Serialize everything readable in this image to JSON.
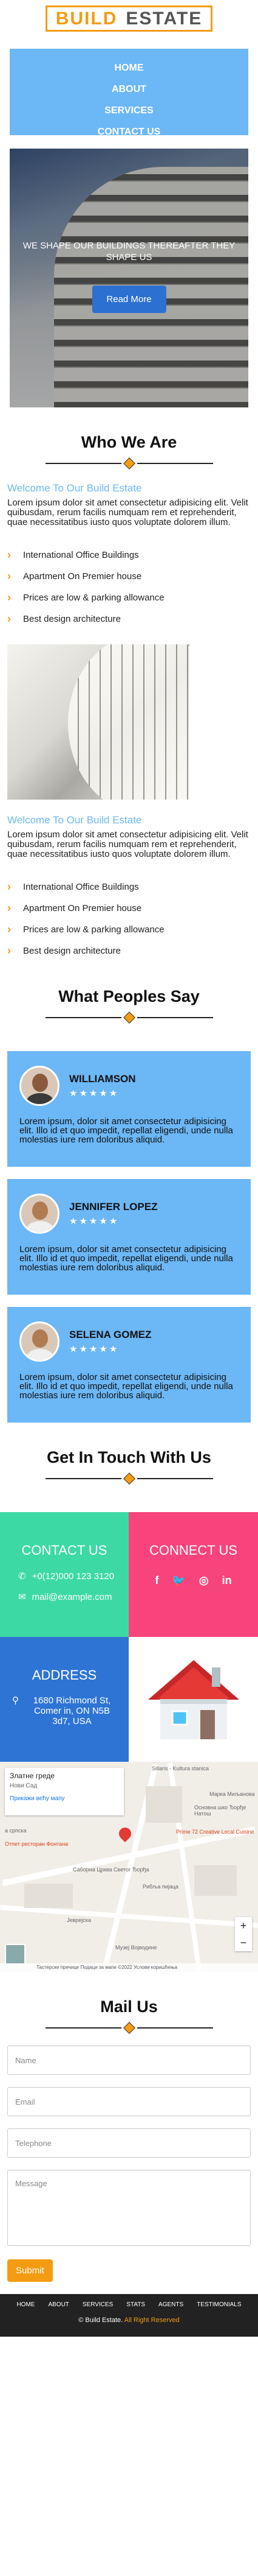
{
  "brand": {
    "part1": "BUILD",
    "part2": "ESTATE"
  },
  "nav": [
    "HOME",
    "ABOUT",
    "SERVICES",
    "CONTACT US"
  ],
  "hero": {
    "headline": "WE SHAPE OUR BUILDINGS THEREAFTER THEY SHAPE US",
    "button": "Read More"
  },
  "about": {
    "title": "Who We Are",
    "blocks": [
      {
        "heading": "Welcome To Our Build Estate",
        "text": "Lorem ipsum dolor sit amet consectetur adipisicing elit. Velit quibusdam, rerum facilis numquam rem et reprehenderit, quae necessitatibus iusto quos voluptate dolorem illum.",
        "features": [
          "International Office Buildings",
          "Apartment On Premier house",
          "Prices are low & parking allowance",
          "Best design architecture"
        ]
      },
      {
        "heading": "Welcome To Our Build Estate",
        "text": "Lorem ipsum dolor sit amet consectetur adipisicing elit. Velit quibusdam, rerum facilis numquam rem et reprehenderit, quae necessitatibus iusto quos voluptate dolorem illum.",
        "features": [
          "International Office Buildings",
          "Apartment On Premier house",
          "Prices are low & parking allowance",
          "Best design architecture"
        ]
      }
    ]
  },
  "testimonials": {
    "title": "What Peoples Say",
    "items": [
      {
        "name": "WILLIAMSON",
        "rating": "★★★★★",
        "text": "Lorem ipsum, dolor sit amet consectetur adipisicing elit. Illo id et quo impedit, repellat eligendi, unde nulla molestias iure rem doloribus aliquid."
      },
      {
        "name": "JENNIFER LOPEZ",
        "rating": "★★★★★",
        "text": "Lorem ipsum, dolor sit amet consectetur adipisicing elit. Illo id et quo impedit, repellat eligendi, unde nulla molestias iure rem doloribus aliquid."
      },
      {
        "name": "SELENA GOMEZ",
        "rating": "★★★★★",
        "text": "Lorem ipsum, dolor sit amet consectetur adipisicing elit. Illo id et quo impedit, repellat eligendi, unde nulla molestias iure rem doloribus aliquid."
      }
    ]
  },
  "contact": {
    "title": "Get In Touch With Us",
    "contact_us": {
      "heading": "CONTACT US",
      "phone": "+0(12)000 123 3120",
      "email": "mail@example.com"
    },
    "connect_us": {
      "heading": "CONNECT US",
      "socials": [
        "f",
        "🐦",
        "◎",
        "in"
      ]
    },
    "address": {
      "heading": "ADDRESS",
      "text": "1680 Richmond St, Comer in, ON N5B 3d7, USA"
    },
    "map": {
      "card_title": "Златне греде",
      "card_sub": "Нови Сад",
      "card_link": "Прикажи већу мапу",
      "labels": [
        "Sillaris - Kultura stanica",
        "Марка Миљанова",
        "Основна шко Ђорђе Натош",
        "Prime 72 Creative Local Cuisine",
        "а српска",
        "Отпет ресторан Фонтана",
        "Саборна Црква Светог Ђорђа",
        "Рибља пијаца",
        "Музеј Војводине",
        "Јеврејска"
      ],
      "footer": "Тастерске пречице   Подаци за мапе ©2022   Услови коришћења",
      "zoom_in": "+",
      "zoom_out": "−"
    }
  },
  "mail": {
    "title": "Mail Us",
    "placeholders": {
      "name": "Name",
      "email": "Email",
      "phone": "Telephone",
      "message": "Message"
    },
    "submit": "Submit"
  },
  "footer": {
    "nav": [
      "HOME",
      "ABOUT",
      "SERVICES",
      "STATS",
      "AGENTS",
      "TESTIMONIALS"
    ],
    "copyright_prefix": "© Build Estate. ",
    "copyright_suffix": "All Right Reserved"
  }
}
